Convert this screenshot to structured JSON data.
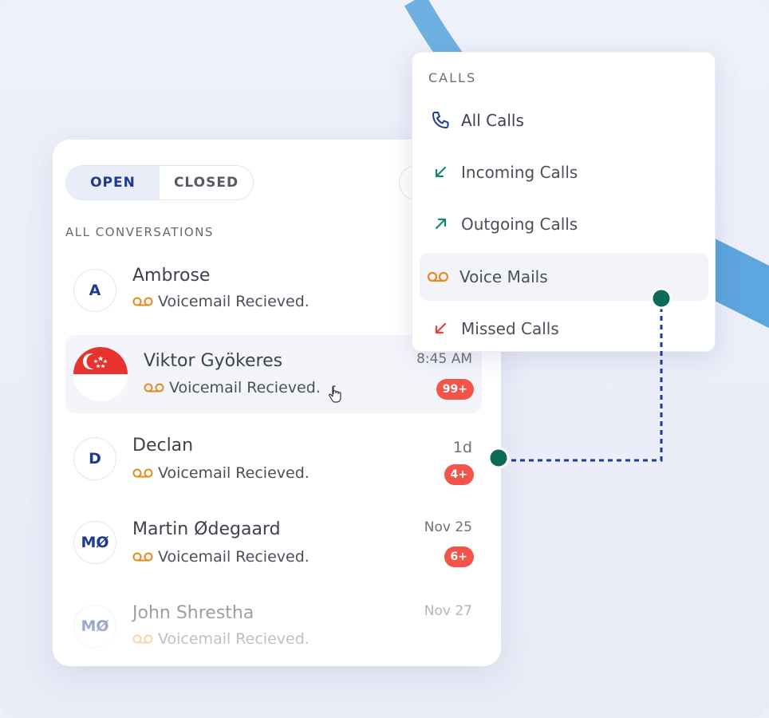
{
  "conversations": {
    "tabs": {
      "open": "OPEN",
      "closed": "CLOSED"
    },
    "section_label": "ALL CONVERSATIONS",
    "items": [
      {
        "initials": "A",
        "name": "Ambrose",
        "preview": "Voicemail Recieved.",
        "time": "",
        "badge": ""
      },
      {
        "initials": "",
        "name": "Viktor Gyökeres",
        "preview": "Voicemail Recieved.",
        "time": "8:45 AM",
        "badge": "99+",
        "flag": "singapore-flag"
      },
      {
        "initials": "D",
        "name": "Declan",
        "preview": "Voicemail Recieved.",
        "time": "1d",
        "badge": "4+"
      },
      {
        "initials": "MØ",
        "name": "Martin Ødegaard",
        "preview": "Voicemail Recieved.",
        "time": "Nov 25",
        "badge": "6+"
      },
      {
        "initials": "MØ",
        "name": "John Shrestha",
        "preview": "Voicemail Recieved.",
        "time": "Nov 27",
        "badge": ""
      }
    ]
  },
  "calls_menu": {
    "title": "CALLS",
    "items": [
      {
        "label": "All Calls",
        "icon": "phone-icon"
      },
      {
        "label": "Incoming Calls",
        "icon": "incoming-arrow-icon"
      },
      {
        "label": "Outgoing Calls",
        "icon": "outgoing-arrow-icon"
      },
      {
        "label": "Voice Mails",
        "icon": "voicemail-icon"
      },
      {
        "label": "Missed Calls",
        "icon": "missed-arrow-icon"
      }
    ],
    "selected": "Voice Mails"
  },
  "colors": {
    "accent_blue": "#1f3a93",
    "voicemail_orange": "#e88a1a",
    "badge_red": "#f2544a",
    "teal": "#0f8a72",
    "missed_red": "#e0443a",
    "connector_green": "#0b6b57"
  }
}
